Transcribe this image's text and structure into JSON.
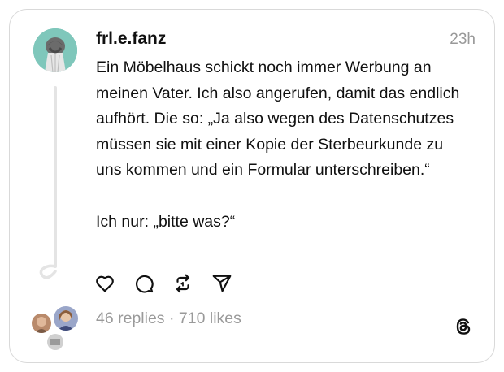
{
  "post": {
    "username": "frl.e.fanz",
    "timestamp": "23h",
    "paragraphs": [
      "Ein Möbelhaus schickt noch immer Werbung an meinen Vater. Ich also angerufen, damit das endlich aufhört. Die so: „Ja also wegen des Datenschutzes müssen sie mit einer Kopie der Sterbeurkunde zu uns kommen und ein Formular unterschreiben.“",
      "Ich nur: „bitte was?“"
    ]
  },
  "actions": {
    "icons": [
      "heart-icon",
      "comment-icon",
      "repost-icon",
      "share-icon"
    ]
  },
  "stats": {
    "replies": "46 replies",
    "separator": " · ",
    "likes": "710 likes"
  },
  "colors": {
    "text": "#101010",
    "muted": "#999999",
    "border": "#d9d9d9",
    "avatar_bg": "#7fc7bb"
  }
}
